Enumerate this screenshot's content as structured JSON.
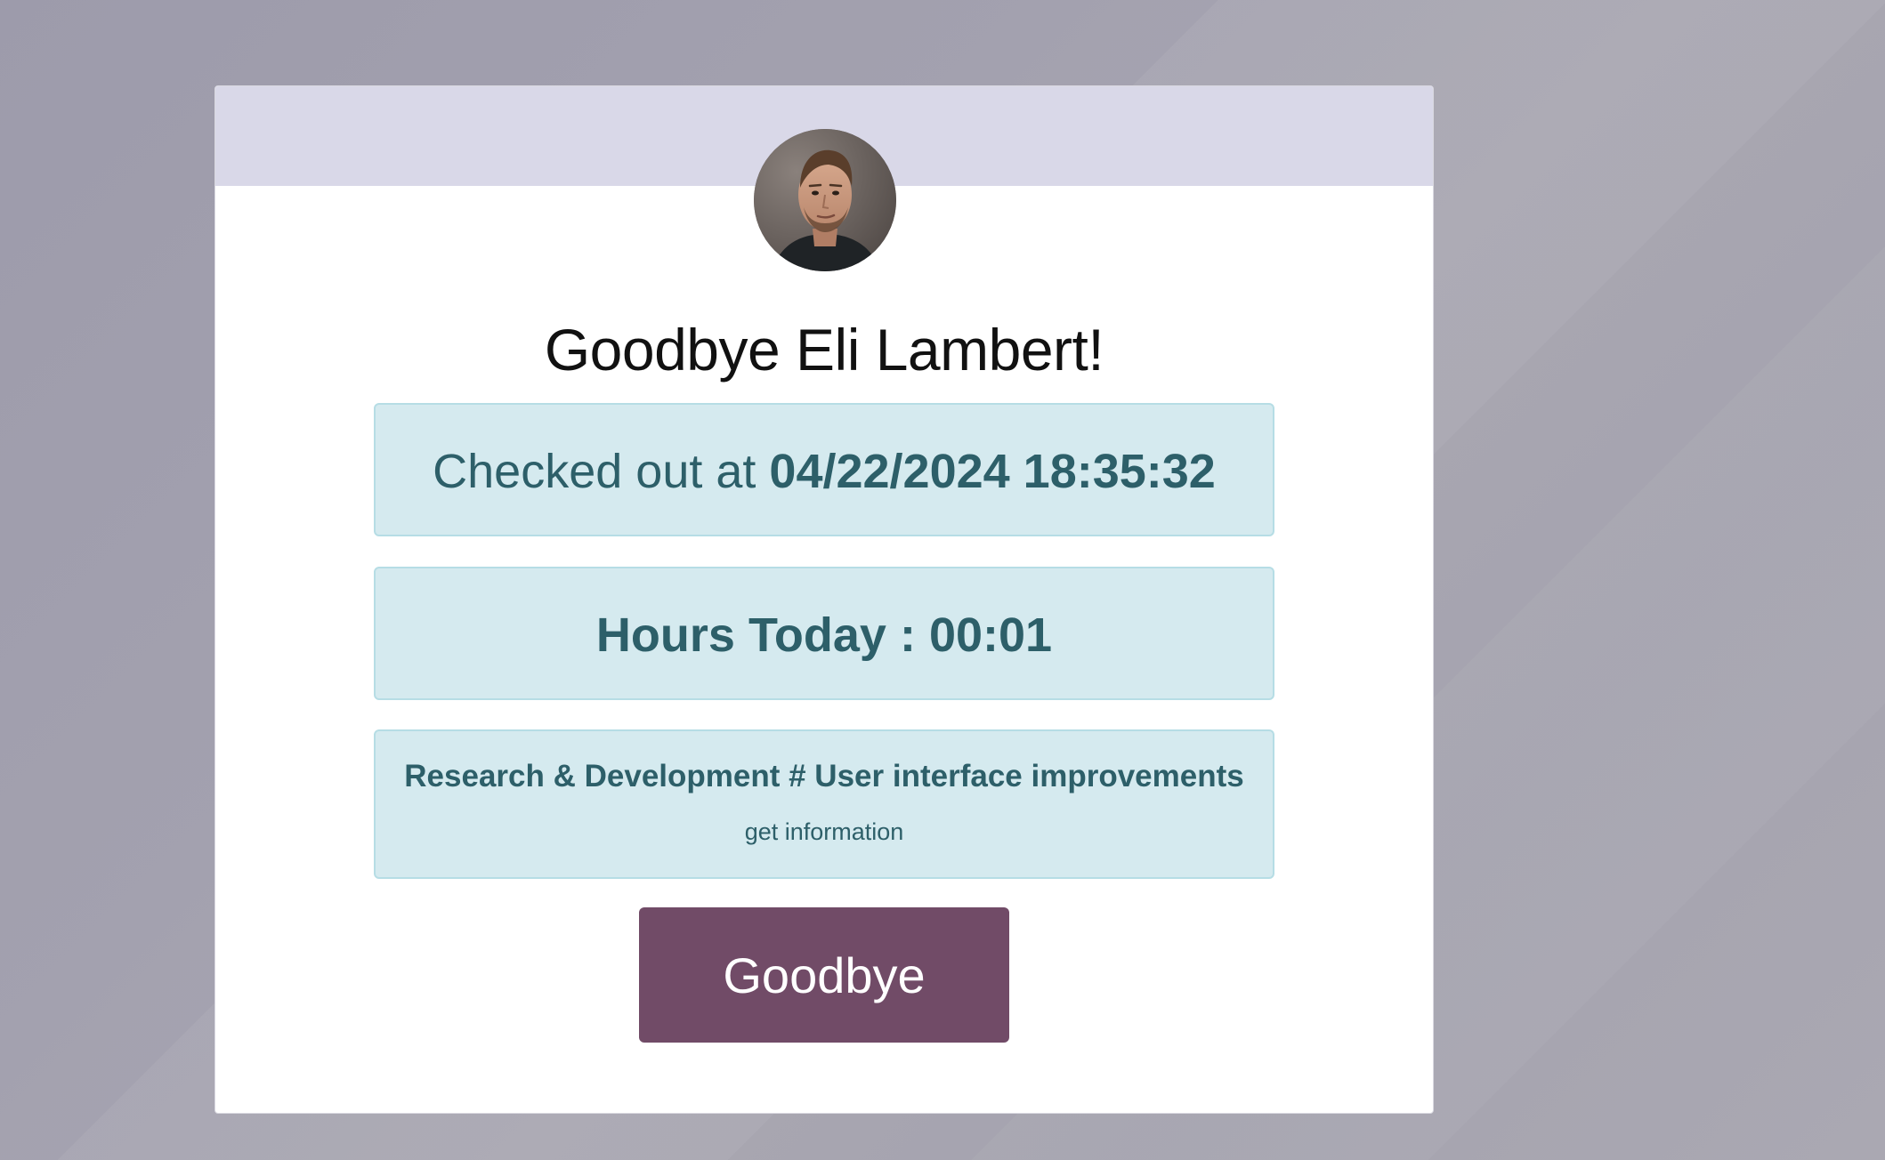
{
  "kiosk": {
    "greeting": "Goodbye Eli Lambert!",
    "checkout_prefix": "Checked out at",
    "checkout_timestamp": "04/22/2024 18:35:32",
    "hours_today": "Hours Today : 00:01",
    "project": "Research & Development # User interface improvements",
    "get_information_link": "get information",
    "goodbye_button": "Goodbye"
  },
  "colors": {
    "header_band": "#d9d8e8",
    "info_box_bg": "#d5eaef",
    "info_box_text": "#2d5f69",
    "button_bg": "#714b67"
  },
  "icons": {
    "avatar": "employee-avatar-photo"
  }
}
